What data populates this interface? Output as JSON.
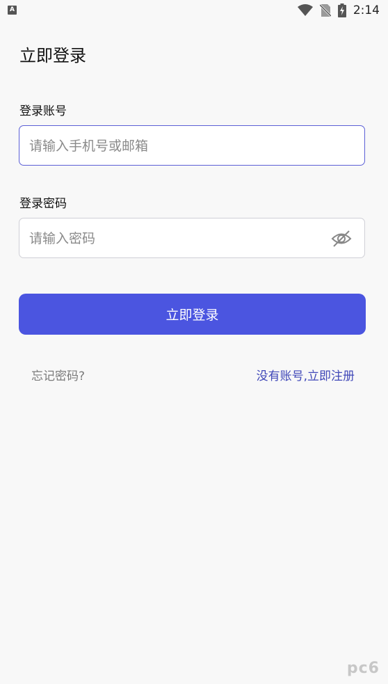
{
  "status_bar": {
    "time": "2:14",
    "left_badge": "A"
  },
  "page": {
    "title": "立即登录"
  },
  "account": {
    "label": "登录账号",
    "placeholder": "请输入手机号或邮箱",
    "value": ""
  },
  "password": {
    "label": "登录密码",
    "placeholder": "请输入密码",
    "value": ""
  },
  "login_button": {
    "label": "立即登录"
  },
  "links": {
    "forgot": "忘记密码?",
    "register": "没有账号,立即注册"
  },
  "watermark": "pc6",
  "colors": {
    "accent": "#4b55e0",
    "link": "#3f47b8",
    "muted_text": "#7a7a7a",
    "input_focus_border": "#5b5fd6",
    "background": "#f8f8f8"
  },
  "icons": {
    "eye_toggle": "eye-off-icon",
    "wifi": "wifi-icon",
    "no_sim": "no-sim-icon",
    "battery": "battery-charging-icon"
  }
}
